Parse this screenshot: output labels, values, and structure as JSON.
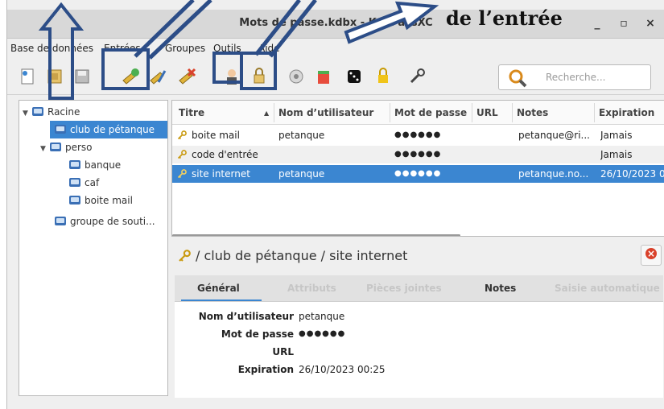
{
  "window": {
    "title": "Mots de passe.kdbx - KeePassXC",
    "minimize": "_",
    "maximize": "▫",
    "close": "×"
  },
  "annotation": {
    "caption": "de l’entrée"
  },
  "menu": [
    "Base de données",
    "Entrées",
    "Groupes",
    "Outils",
    "Aide"
  ],
  "toolbar": {
    "icons": [
      "new-database-icon",
      "open-database-icon",
      "save-database-icon",
      "add-entry-icon",
      "edit-entry-icon",
      "delete-entry-icon",
      "copy-username-icon",
      "copy-password-icon",
      "copy-url-icon",
      "autotype-icon",
      "password-generator-icon",
      "lock-database-icon",
      "settings-icon"
    ],
    "search_placeholder": "Recherche..."
  },
  "tree": {
    "root": "Racine",
    "items": [
      {
        "label": "club de pétanque",
        "selected": true
      },
      {
        "label": "perso"
      },
      {
        "label": "banque"
      },
      {
        "label": "caf"
      },
      {
        "label": "boite mail"
      },
      {
        "label": "groupe de souti..."
      }
    ]
  },
  "table": {
    "columns": [
      "Titre",
      "Nom d’utilisateur",
      "Mot de passe",
      "URL",
      "Notes",
      "Expiration"
    ],
    "rows": [
      {
        "title": "boite mail",
        "username": "petanque",
        "password": "●●●●●●",
        "url": "",
        "notes": "petanque@ri...",
        "expiration": "Jamais"
      },
      {
        "title": "code d'entrée",
        "username": "",
        "password": "●●●●●●",
        "url": "",
        "notes": "",
        "expiration": "Jamais"
      },
      {
        "title": "site internet",
        "username": "petanque",
        "password": "●●●●●●",
        "url": "",
        "notes": "petanque.no...",
        "expiration": "26/10/2023 0..."
      }
    ]
  },
  "details": {
    "path": "/ club de pétanque / site internet",
    "tabs": [
      "Général",
      "Attributs",
      "Pièces jointes",
      "Notes",
      "Saisie automatique"
    ],
    "fields": [
      {
        "label": "Nom d’utilisateur",
        "value": "petanque"
      },
      {
        "label": "Mot de passe",
        "value": "●●●●●●"
      },
      {
        "label": "URL",
        "value": ""
      },
      {
        "label": "Expiration",
        "value": "26/10/2023 00:25"
      }
    ]
  },
  "colors": {
    "accent": "#3b86d1",
    "annotation": "#2c4d87"
  }
}
